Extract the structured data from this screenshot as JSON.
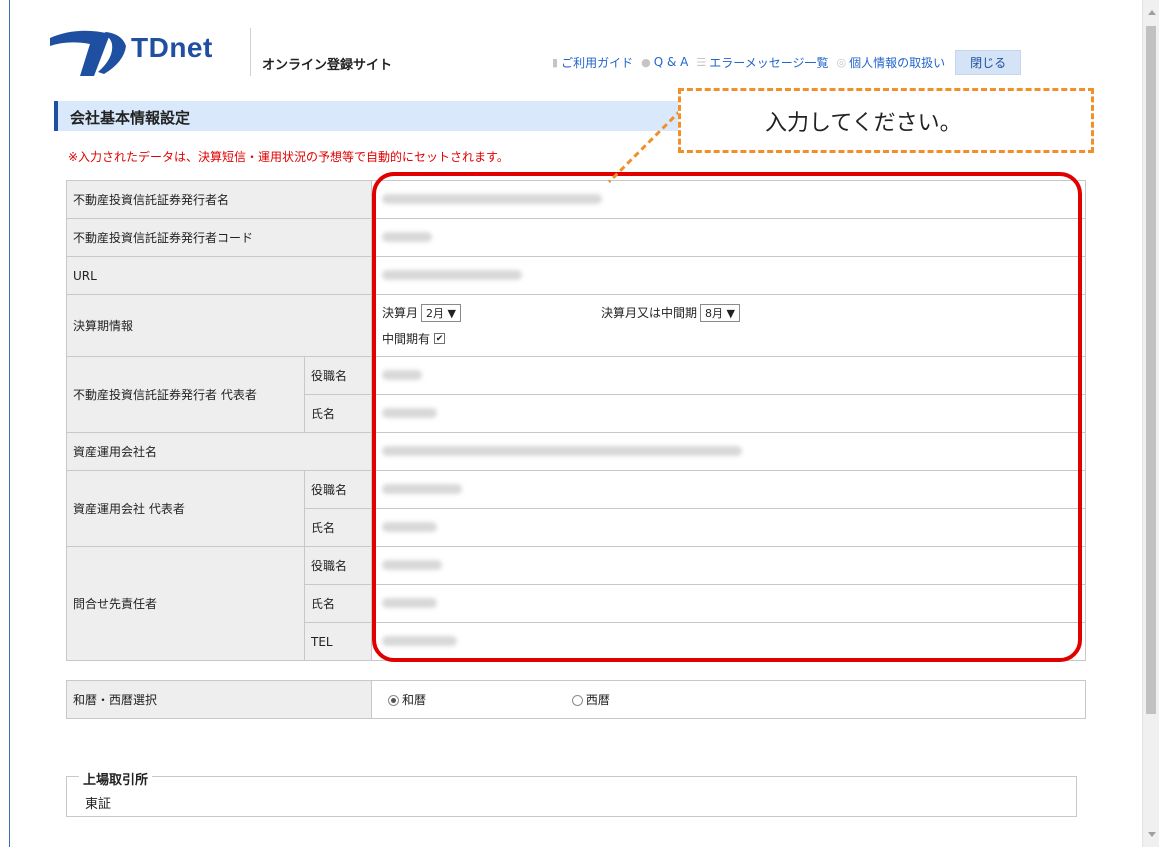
{
  "header": {
    "logo_text": "TDnet",
    "site_title": "オンライン登録サイト",
    "nav": [
      {
        "label": "ご利用ガイド",
        "icon": "book-icon"
      },
      {
        "label": "Q & A",
        "icon": "speech-bubble-icon"
      },
      {
        "label": "エラーメッセージ一覧",
        "icon": "list-icon"
      },
      {
        "label": "個人情報の取扱い",
        "icon": "target-icon"
      }
    ],
    "close_label": "閉じる"
  },
  "section_title": "会社基本情報設定",
  "notice": "※入力されたデータは、決算短信・運用状況の予想等で自動的にセットされます。",
  "callout_text": "入力してください。",
  "rows": {
    "issuer_name": "不動産投資信託証券発行者名",
    "issuer_code": "不動産投資信託証券発行者コード",
    "url": "URL",
    "fiscal_info": "決算期情報",
    "issuer_rep": "不動産投資信託証券発行者 代表者",
    "asset_mgr": "資産運用会社名",
    "asset_mgr_rep": "資産運用会社 代表者",
    "contact": "問合せ先責任者",
    "title_label": "役職名",
    "name_label": "氏名",
    "tel_label": "TEL"
  },
  "fiscal": {
    "month_label": "決算月",
    "month_value": "2月",
    "interim_label": "決算月又は中間期",
    "interim_value": "8月",
    "interim_check_label": "中間期有",
    "interim_checked": true
  },
  "era": {
    "label": "和暦・西暦選択",
    "option_japanese": "和暦",
    "option_western": "西暦",
    "selected": "和暦"
  },
  "exchange": {
    "legend": "上場取引所",
    "value": "東証"
  },
  "colors": {
    "brand": "#1f4fa0",
    "notice": "#e00000",
    "callout_border": "#f0902a",
    "highlight": "#e00000"
  }
}
